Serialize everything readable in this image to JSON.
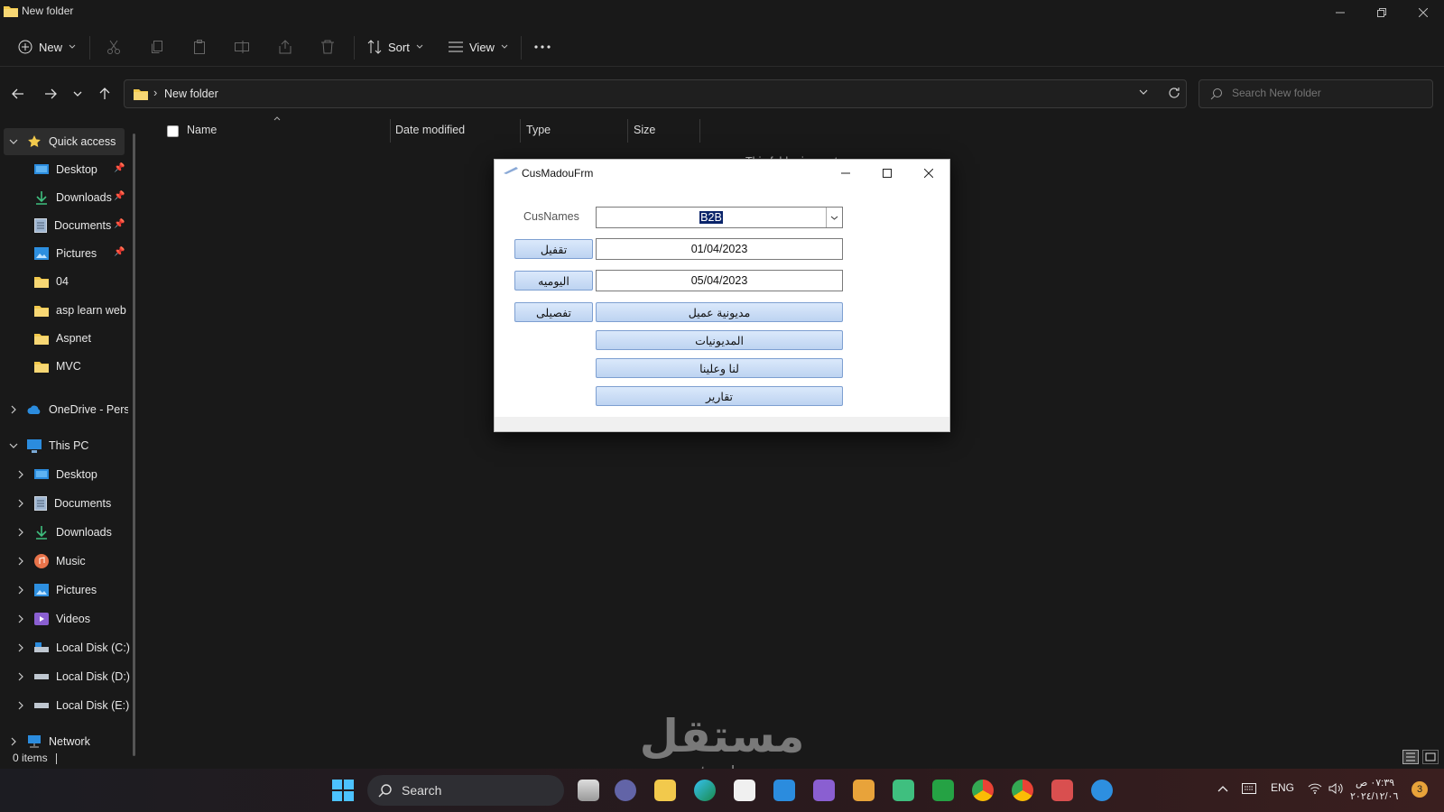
{
  "window": {
    "title": "New folder"
  },
  "toolbar": {
    "new_label": "New",
    "sort_label": "Sort",
    "view_label": "View"
  },
  "address": {
    "path": "New folder",
    "search_placeholder": "Search New folder"
  },
  "sidebar": {
    "quick_access": "Quick access",
    "quick_items": [
      "Desktop",
      "Downloads",
      "Documents",
      "Pictures",
      "04",
      "asp learn web s",
      "Aspnet",
      "MVC"
    ],
    "onedrive": "OneDrive - Perso",
    "this_pc": "This PC",
    "pc_items": [
      "Desktop",
      "Documents",
      "Downloads",
      "Music",
      "Pictures",
      "Videos",
      "Local Disk (C:)",
      "Local Disk (D:)",
      "Local Disk (E:)"
    ],
    "network": "Network"
  },
  "columns": [
    "Name",
    "Date modified",
    "Type",
    "Size"
  ],
  "content": {
    "empty_text": "This folder is empty."
  },
  "status": {
    "items": "0 items"
  },
  "dialog": {
    "title": "CusMadouFrm",
    "cus_label": "CusNames",
    "cus_value": "B2B",
    "date_from": "01/04/2023",
    "date_to": "05/04/2023",
    "btn_close_period": "تقفيل",
    "btn_daily": "اليوميه",
    "btn_detail": "تفصيلى",
    "btn_customer_debt": "مديونية عميل",
    "btn_debts": "المديونيات",
    "btn_receivables": "لنا وعلينا",
    "btn_reports": "تقارير"
  },
  "watermark": {
    "arabic": "مستقل",
    "latin": "mostaql.com"
  },
  "taskbar": {
    "search_label": "Search",
    "lang": "ENG",
    "time": "٠٧:٣٩ ص",
    "date": "٢٠٢٤/١٢/٠٦",
    "notif_count": "3"
  }
}
